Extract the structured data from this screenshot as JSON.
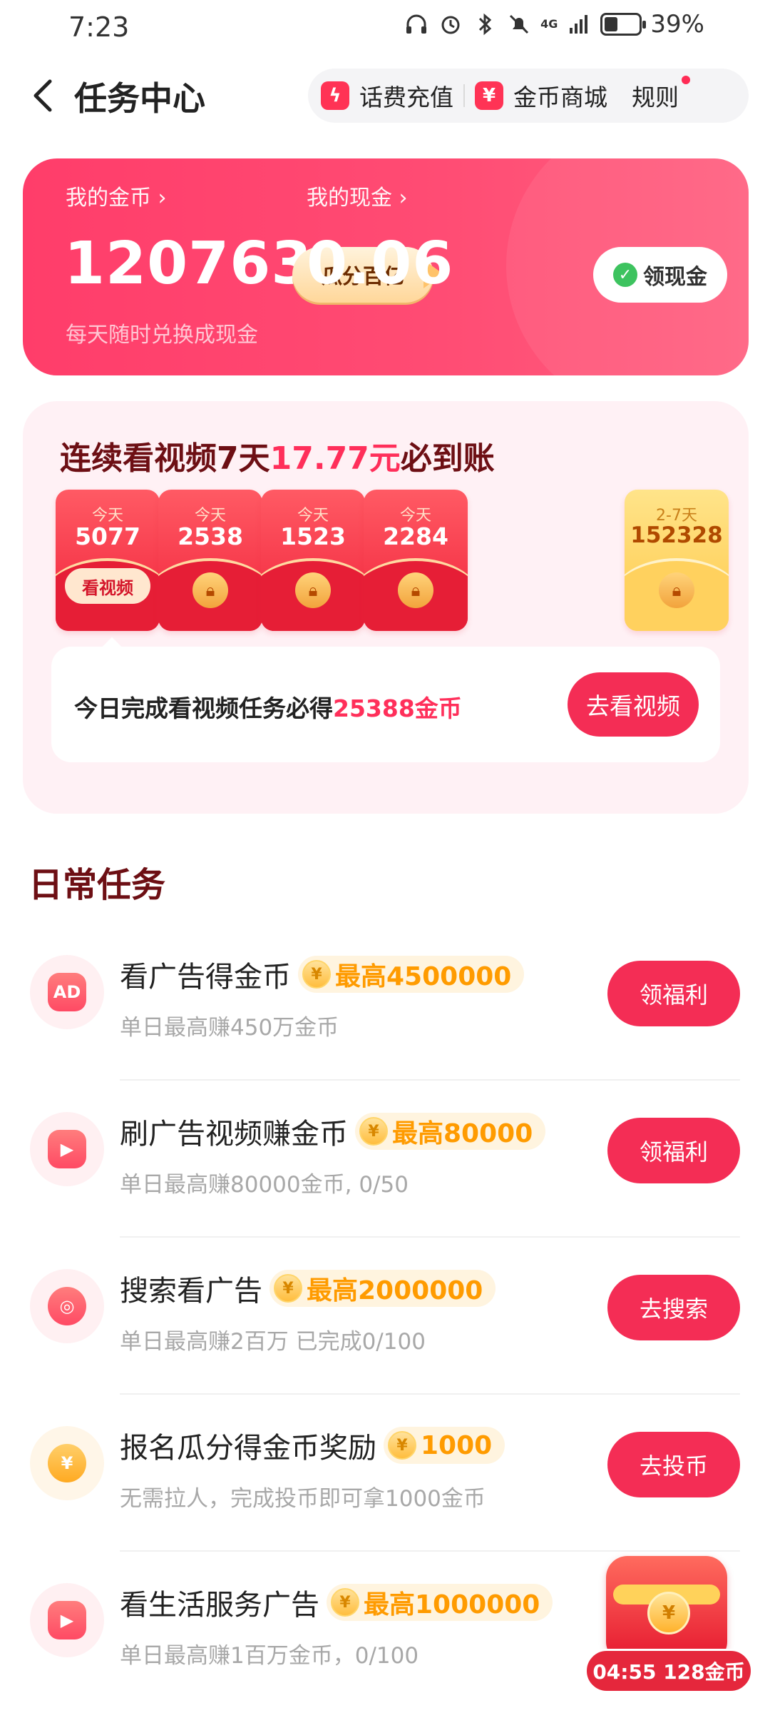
{
  "status_bar": {
    "time": "7:23",
    "network": "4G",
    "battery_percent": "39%"
  },
  "header": {
    "title": "任务中心",
    "links": {
      "recharge": {
        "icon": "lightning-icon",
        "label": "话费充值"
      },
      "mall": {
        "icon": "ticket-icon",
        "label": "金币商城"
      },
      "rules": {
        "label": "规则"
      }
    }
  },
  "wallet": {
    "coins_label": "我的金币",
    "coins_value": "120763",
    "split_badge": "瓜分百亿",
    "cash_label": "我的现金",
    "cash_value": "0.06",
    "claim_cash_button": "领现金",
    "hint": "每天随时兑换成现金"
  },
  "streak": {
    "title_prefix": "连续看视频7天",
    "title_amount": "17.77元",
    "title_suffix": "必到账",
    "days": [
      {
        "label": "今天",
        "value": "5077",
        "state": "active",
        "action": "看视频"
      },
      {
        "label": "今天",
        "value": "2538",
        "state": "locked"
      },
      {
        "label": "今天",
        "value": "1523",
        "state": "locked"
      },
      {
        "label": "今天",
        "value": "2284",
        "state": "locked"
      },
      {
        "label": "2-7天",
        "value": "152328",
        "state": "gold-locked"
      }
    ],
    "today_text_prefix": "今日完成看视频任务必得",
    "today_text_amount": "25388金币",
    "watch_button": "去看视频"
  },
  "daily_tasks": {
    "title": "日常任务",
    "items": [
      {
        "icon": "ad-icon",
        "icon_text": "AD",
        "title": "看广告得金币",
        "reward": "最高4500000",
        "subtitle": "单日最高赚450万金币",
        "button": "领福利"
      },
      {
        "icon": "video-icon",
        "icon_text": "▶",
        "title": "刷广告视频赚金币",
        "reward": "最高80000",
        "subtitle": "单日最高赚80000金币, 0/50",
        "button": "领福利"
      },
      {
        "icon": "search-play-icon",
        "icon_text": "◎",
        "title": "搜索看广告",
        "reward": "最高2000000",
        "subtitle": "单日最高赚2百万 已完成0/100",
        "button": "去搜索"
      },
      {
        "icon": "yuan-coin-icon",
        "icon_text": "¥",
        "title": "报名瓜分得金币奖励",
        "reward": "1000",
        "subtitle": "无需拉人，完成投币即可拿1000金币",
        "button": "去投币"
      },
      {
        "icon": "play-icon",
        "icon_text": "▶",
        "title": "看生活服务广告",
        "reward": "最高1000000",
        "subtitle": "单日最高赚1百万金币，0/100",
        "button": ""
      }
    ]
  },
  "floating_reward": {
    "timer": "04:55 128金币"
  },
  "colors": {
    "primary": "#f42d55",
    "card_gradient_start": "#ff3d6a",
    "reward_orange": "#ff9b00",
    "title_dark_red": "#6d0f14"
  }
}
